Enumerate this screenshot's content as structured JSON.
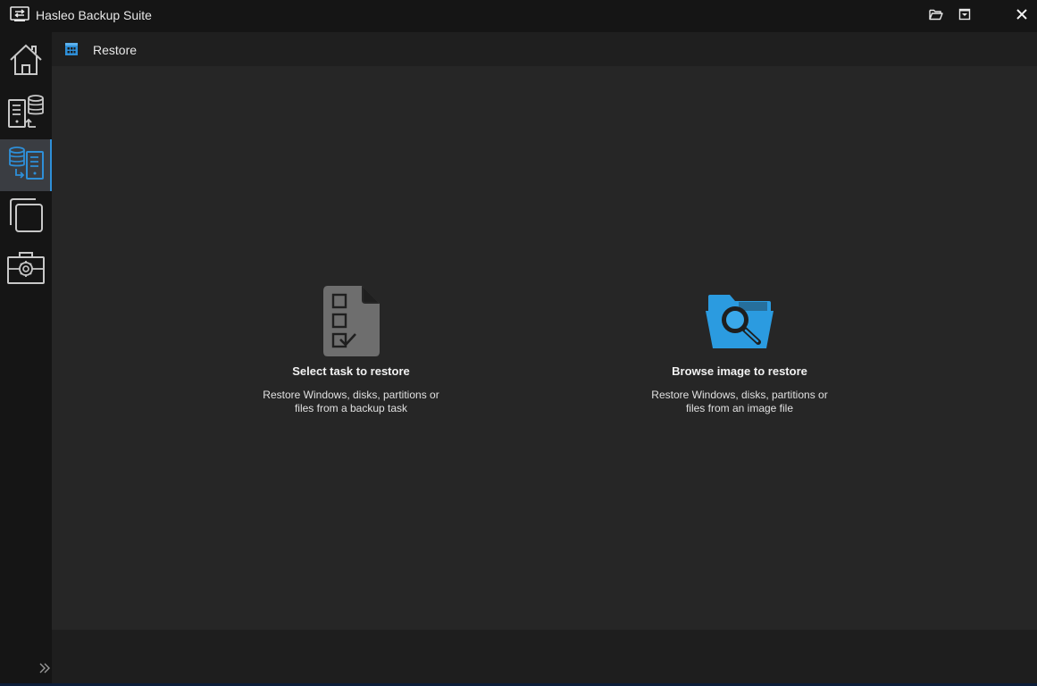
{
  "window": {
    "title": "Hasleo Backup Suite"
  },
  "titlebar_buttons": [
    {
      "name": "open-folder-icon"
    },
    {
      "name": "minimize-icon"
    },
    {
      "name": "close-icon"
    }
  ],
  "sidebar": {
    "items": [
      {
        "id": "home",
        "icon": "home-icon",
        "active": false
      },
      {
        "id": "backup",
        "icon": "backup-icon",
        "active": false
      },
      {
        "id": "restore",
        "icon": "restore-icon",
        "active": true
      },
      {
        "id": "clone",
        "icon": "clone-icon",
        "active": false
      },
      {
        "id": "tools",
        "icon": "toolbox-gear-icon",
        "active": false
      }
    ],
    "expand_icon": "double-chevron-right-icon"
  },
  "header": {
    "title": "Restore",
    "icon": "restore-grid-icon"
  },
  "main": {
    "options": [
      {
        "title": "Select task to restore",
        "desc_line1": "Restore Windows, disks, partitions or",
        "desc_line2": "files from a backup task",
        "icon": "checklist-document-icon"
      },
      {
        "title": "Browse image to restore",
        "desc_line1": "Restore Windows, disks, partitions or",
        "desc_line2": "files from an image file",
        "icon": "folder-search-icon"
      }
    ]
  },
  "colors": {
    "accent": "#2e8fd8",
    "sidebar_bg": "#151515",
    "content_bg": "#262626",
    "active_nav_bg": "#3a3d42",
    "folder_blue": "#2b9be0",
    "doc_gray": "#6e6e6e"
  }
}
